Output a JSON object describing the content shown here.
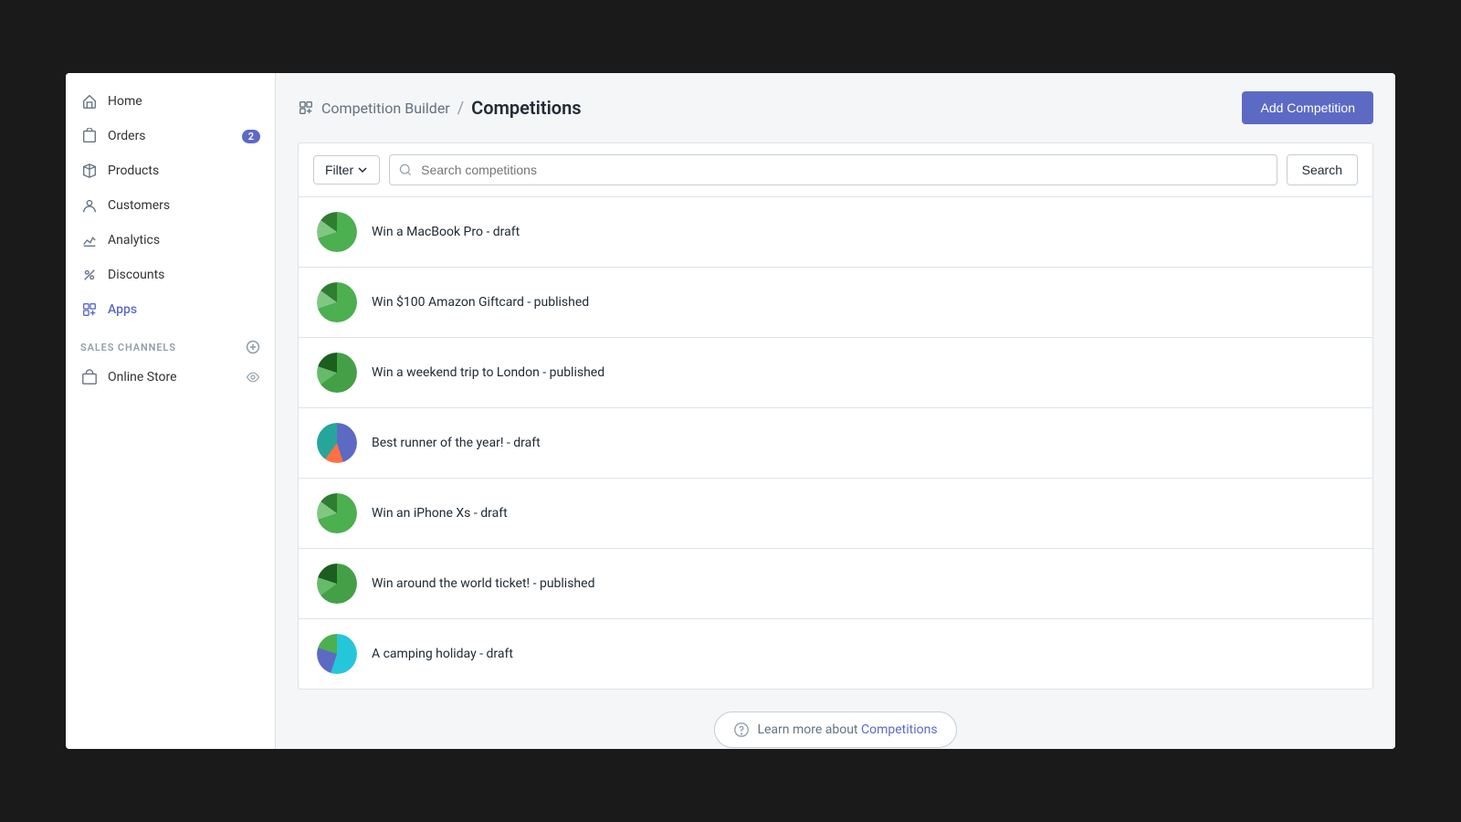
{
  "sidebar": {
    "items": [
      {
        "id": "home",
        "label": "Home",
        "icon": "home"
      },
      {
        "id": "orders",
        "label": "Orders",
        "icon": "orders",
        "badge": "2"
      },
      {
        "id": "products",
        "label": "Products",
        "icon": "products"
      },
      {
        "id": "customers",
        "label": "Customers",
        "icon": "customers"
      },
      {
        "id": "analytics",
        "label": "Analytics",
        "icon": "analytics"
      },
      {
        "id": "discounts",
        "label": "Discounts",
        "icon": "discounts"
      },
      {
        "id": "apps",
        "label": "Apps",
        "icon": "apps",
        "active": true
      }
    ],
    "sales_channels_label": "SALES CHANNELS",
    "online_store_label": "Online Store"
  },
  "header": {
    "breadcrumb_root": "Competition Builder",
    "breadcrumb_current": "Competitions",
    "add_button_label": "Add Competition"
  },
  "filter": {
    "filter_label": "Filter",
    "search_placeholder": "Search competitions",
    "search_button_label": "Search"
  },
  "competitions": [
    {
      "id": 1,
      "title": "Win a MacBook Pro - draft",
      "avatar_type": "green-pie"
    },
    {
      "id": 2,
      "title": "Win $100 Amazon Giftcard - published",
      "avatar_type": "green-pie"
    },
    {
      "id": 3,
      "title": "Win a weekend trip to London - published",
      "avatar_type": "green-pie2"
    },
    {
      "id": 4,
      "title": "Best runner of the year! - draft",
      "avatar_type": "purple-pie"
    },
    {
      "id": 5,
      "title": "Win an iPhone Xs - draft",
      "avatar_type": "green-pie"
    },
    {
      "id": 6,
      "title": "Win around the world ticket! - published",
      "avatar_type": "green-pie2"
    },
    {
      "id": 7,
      "title": "A camping holiday - draft",
      "avatar_type": "teal-pie"
    }
  ],
  "footer": {
    "learn_more_text": "Learn more about ",
    "learn_more_link": "Competitions"
  }
}
